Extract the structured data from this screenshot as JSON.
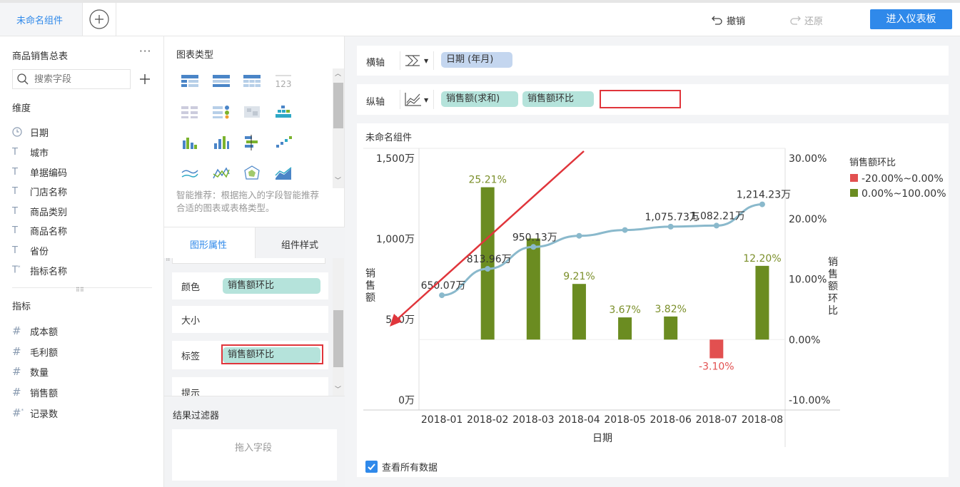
{
  "top": {
    "tab_name": "未命名组件",
    "add_icon": "plus-circle-icon",
    "undo_label": "撤销",
    "redo_label": "还原",
    "enter_dashboard_label": "进入仪表板",
    "accent": "#2f89ea"
  },
  "left": {
    "table_name": "商品销售总表",
    "more_icon": "ellipsis-icon",
    "search_placeholder": "搜索字段",
    "dimension_title": "维度",
    "dimensions": [
      {
        "icon": "clock-icon",
        "label": "日期"
      },
      {
        "icon": "text-T-icon",
        "label": "城市"
      },
      {
        "icon": "text-T-icon",
        "label": "单据编码"
      },
      {
        "icon": "text-T-icon",
        "label": "门店名称"
      },
      {
        "icon": "text-T-icon",
        "label": "商品类别"
      },
      {
        "icon": "text-T-icon",
        "label": "商品名称"
      },
      {
        "icon": "text-T-icon",
        "label": "省份"
      },
      {
        "icon": "text-T-star-icon",
        "label": "指标名称"
      }
    ],
    "measure_title": "指标",
    "measures": [
      {
        "icon": "hash-icon",
        "label": "成本额"
      },
      {
        "icon": "hash-icon",
        "label": "毛利额"
      },
      {
        "icon": "hash-icon",
        "label": "数量"
      },
      {
        "icon": "hash-icon",
        "label": "销售额"
      },
      {
        "icon": "hash-star-icon",
        "label": "记录数"
      }
    ]
  },
  "middle": {
    "chart_type_title": "图表类型",
    "recommend_text": "智能推荐：根据拖入的字段智能推荐合适的图表或表格类型。",
    "tab_graph_props": "图形属性",
    "tab_component_style": "组件样式",
    "props": [
      {
        "label": "颜色",
        "value": "销售额环比"
      },
      {
        "label": "大小",
        "value": ""
      },
      {
        "label": "标签",
        "value": "销售额环比"
      },
      {
        "label": "提示",
        "value": ""
      }
    ],
    "filter_title": "结果过滤器",
    "filter_placeholder": "拖入字段"
  },
  "axes": {
    "x_label": "横轴",
    "x_field": "日期 (年月)",
    "y_label": "纵轴",
    "y_fields": [
      "销售额(求和)",
      "销售额环比"
    ]
  },
  "chart_panel": {
    "title": "未命名组件",
    "view_all_label": "查看所有数据",
    "view_all_checked": true
  },
  "chart_data": {
    "type": "bar",
    "title": "",
    "categories": [
      "2018-01",
      "2018-02",
      "2018-03",
      "2018-04",
      "2018-05",
      "2018-06",
      "2018-07",
      "2018-08"
    ],
    "xlabel": "日期",
    "ylabel_left": "销售额",
    "ylabel_right": "销售额环比",
    "left_ticks": [
      "1,500万",
      "1,000万",
      "500万",
      "0万"
    ],
    "left_tick_values": [
      1500,
      1000,
      500,
      0
    ],
    "right_ticks": [
      "30.00%",
      "20.00%",
      "10.00%",
      "0.00%",
      "-10.00%"
    ],
    "right_tick_values": [
      30,
      20,
      10,
      0,
      -10
    ],
    "ylim_left": [
      0,
      1500
    ],
    "ylim_right": [
      -10,
      30
    ],
    "series": [
      {
        "name": "销售额环比",
        "kind": "bar",
        "axis": "right",
        "values": [
          null,
          25.21,
          16.73,
          9.21,
          3.67,
          3.82,
          -3.1,
          12.2
        ],
        "labels": [
          "",
          "25.21%",
          "",
          "9.21%",
          "3.67%",
          "3.82%",
          "-3.10%",
          "12.20%"
        ]
      },
      {
        "name": "销售额(求和)",
        "kind": "line",
        "axis": "left",
        "values": [
          650.07,
          813.96,
          950.13,
          1019.0,
          1055.0,
          1075.73,
          1082.21,
          1214.23
        ],
        "labels": [
          "650.07万",
          "813.96万",
          "950.13万",
          "",
          "",
          "1,075.73万",
          "1,082.21万",
          "1,214.23万"
        ]
      }
    ],
    "legend": {
      "title": "销售额环比",
      "position": "right",
      "items": [
        {
          "label": "-20.00%~0.00%",
          "color": "#e25050"
        },
        {
          "label": "0.00%~100.00%",
          "color": "#6b8c21"
        }
      ]
    },
    "colors": {
      "positive": "#6b8c21",
      "negative": "#e25050",
      "line": "#8ab9cc"
    }
  }
}
